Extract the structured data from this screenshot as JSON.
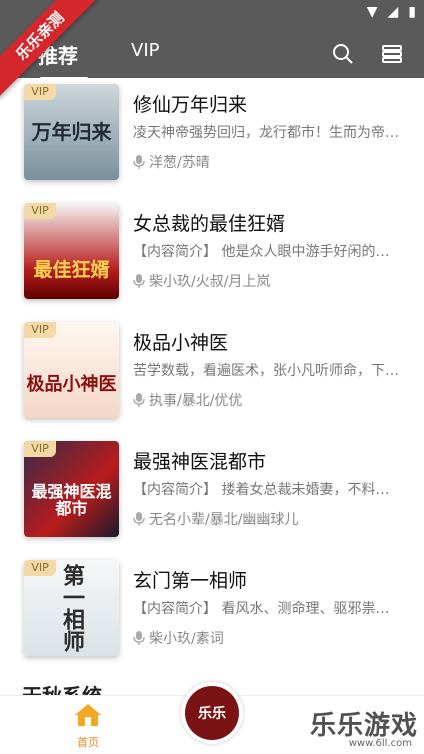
{
  "ribbon": "乐乐亲测",
  "tabs": {
    "recommend": "推荐",
    "vip": "VIP"
  },
  "books": [
    {
      "title": "修仙万年归来",
      "desc": "凌天神帝强势回归，龙行都市！生而为帝…",
      "author": "洋葱/苏晴",
      "vip": "VIP",
      "cover_text": "万年归来"
    },
    {
      "title": "女总裁的最佳狂婿",
      "desc": "【内容简介】 他是众人眼中游手好闲的小…",
      "author": "柴小玖/火叔/月上岚",
      "vip": "VIP",
      "cover_text": "最佳狂婿"
    },
    {
      "title": "极品小神医",
      "desc": "苦学数载，看遍医术，张小凡听师命，下…",
      "author": "执事/暴北/优优",
      "vip": "VIP",
      "cover_text": "极品小神医"
    },
    {
      "title": "最强神医混都市",
      "desc": "【内容简介】 搂着女总裁未婚妻，不料闺…",
      "author": "无名小辈/暴北/幽幽球儿",
      "vip": "VIP",
      "cover_text": "最强神医混都市"
    },
    {
      "title": "玄门第一相师",
      "desc": "【内容简介】 看风水、测命理、驱邪祟、…",
      "author": "柴小玖/素词",
      "vip": "VIP",
      "cover_text": "第一相师"
    }
  ],
  "partial_title": "天秋系统",
  "nav": {
    "home": "首页",
    "center_text": "乐乐"
  },
  "watermark": {
    "main": "乐乐游戏",
    "sub": "www.6ll.com"
  },
  "colors": {
    "header": "#5a5a5a",
    "accent": "#f08a1c",
    "ribbon": "#d5262b"
  }
}
